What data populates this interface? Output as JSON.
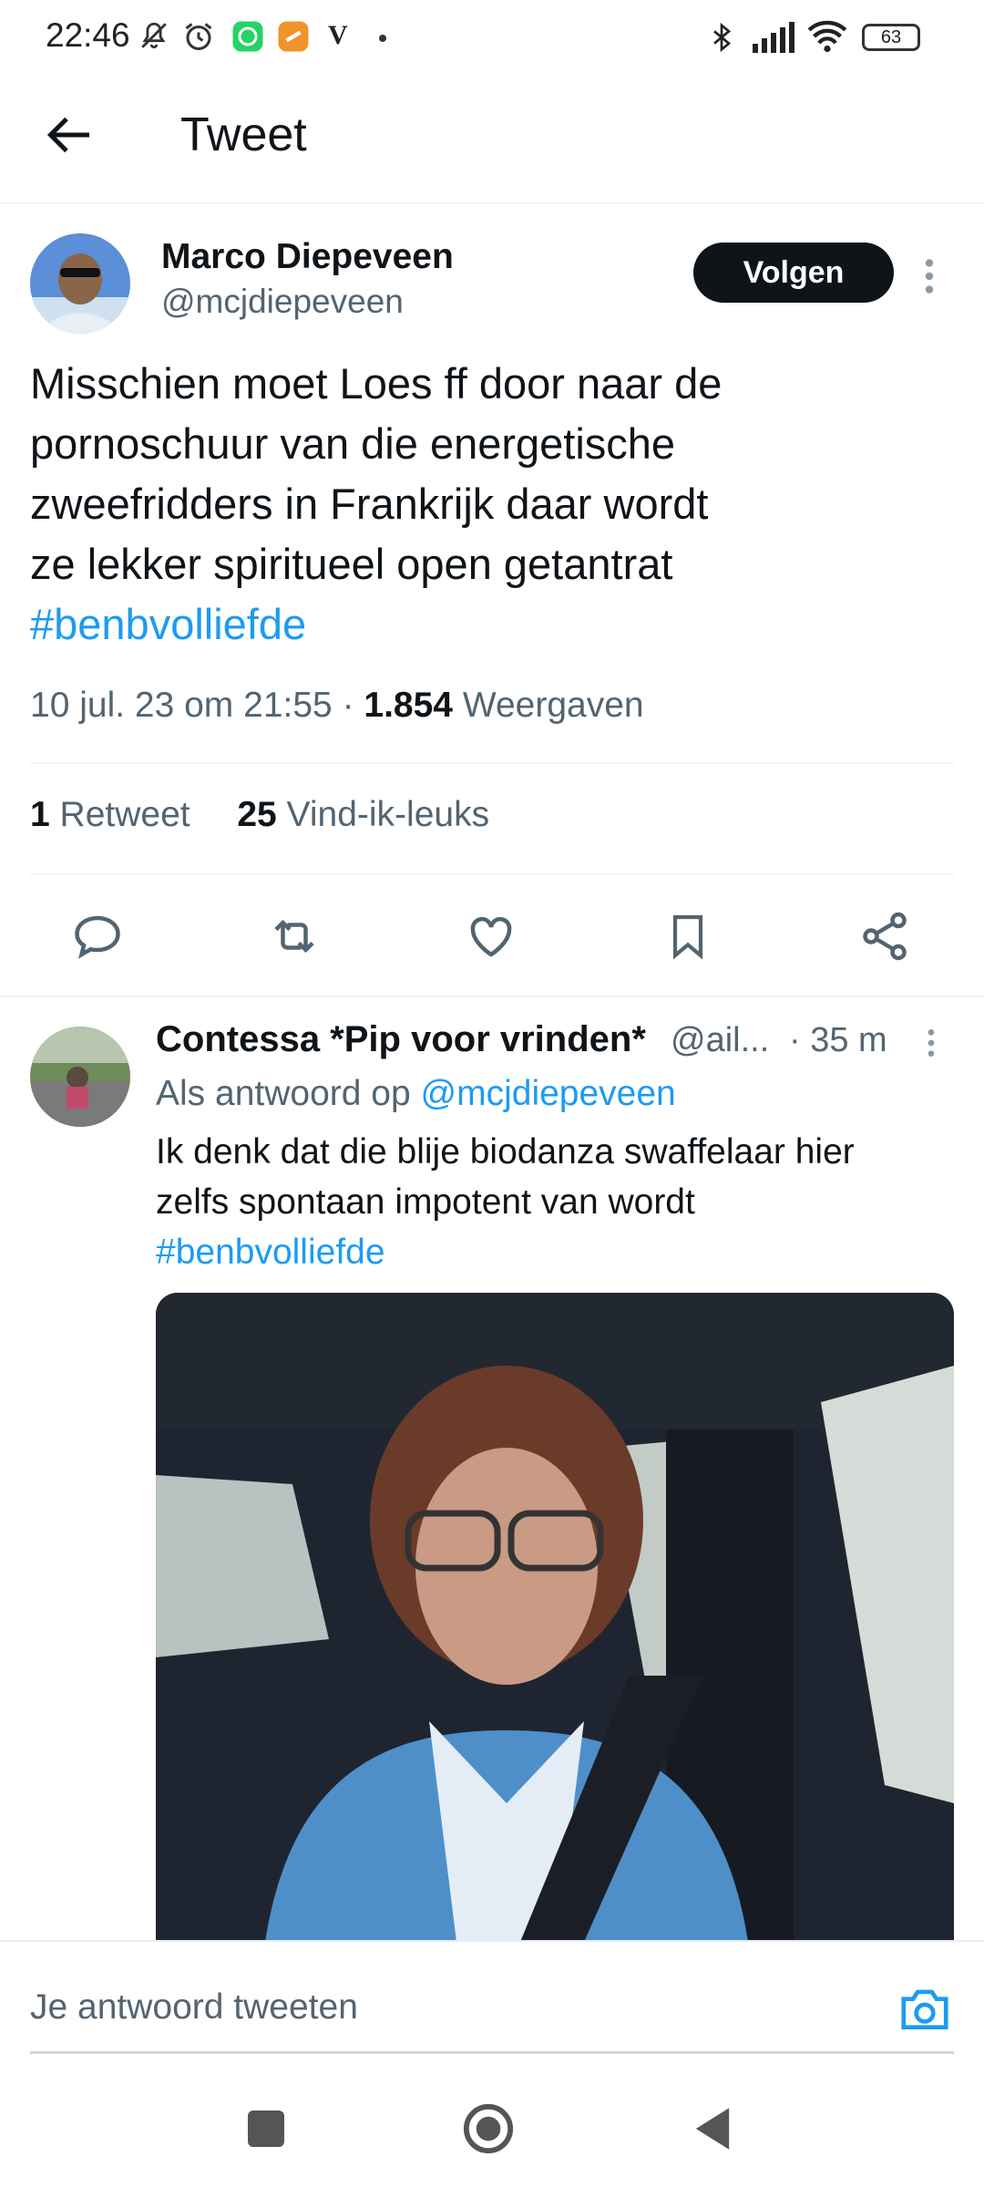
{
  "status_bar": {
    "time": "22:46",
    "battery": "63",
    "carrier_letter": "V"
  },
  "header": {
    "title": "Tweet"
  },
  "tweet": {
    "author_name": "Marco Diepeveen",
    "author_handle": "@mcjdiepeveen",
    "follow_label": "Volgen",
    "text_lines": [
      "Misschien moet Loes ff door naar de",
      "pornoschuur van die energetische",
      "zweefridders in Frankrijk daar wordt",
      "ze lekker spiritueel open getantrat"
    ],
    "hashtag": "#benbvolliefde",
    "date": "10 jul. 23 om 21:55",
    "views_count": "1.854",
    "views_label": "Weergaven",
    "retweet_count": "1",
    "retweet_label": "Retweet",
    "like_count": "25",
    "like_label": "Vind-ik-leuks"
  },
  "reply": {
    "author_name": "Contessa *Pip voor vrinden*",
    "author_handle": "@ail...",
    "time": "· 35 m",
    "reply_prefix": "Als antwoord op ",
    "reply_to": "@mcjdiepeveen",
    "text_lines": [
      "Ik denk dat die blije biodanza swaffelaar hier",
      "zelfs spontaan impotent van wordt"
    ],
    "hashtag": "#benbvolliefde"
  },
  "compose": {
    "placeholder": "Je antwoord tweeten"
  },
  "colors": {
    "accent": "#1d9bf0",
    "text": "#0f1419",
    "secondary": "#536471"
  }
}
